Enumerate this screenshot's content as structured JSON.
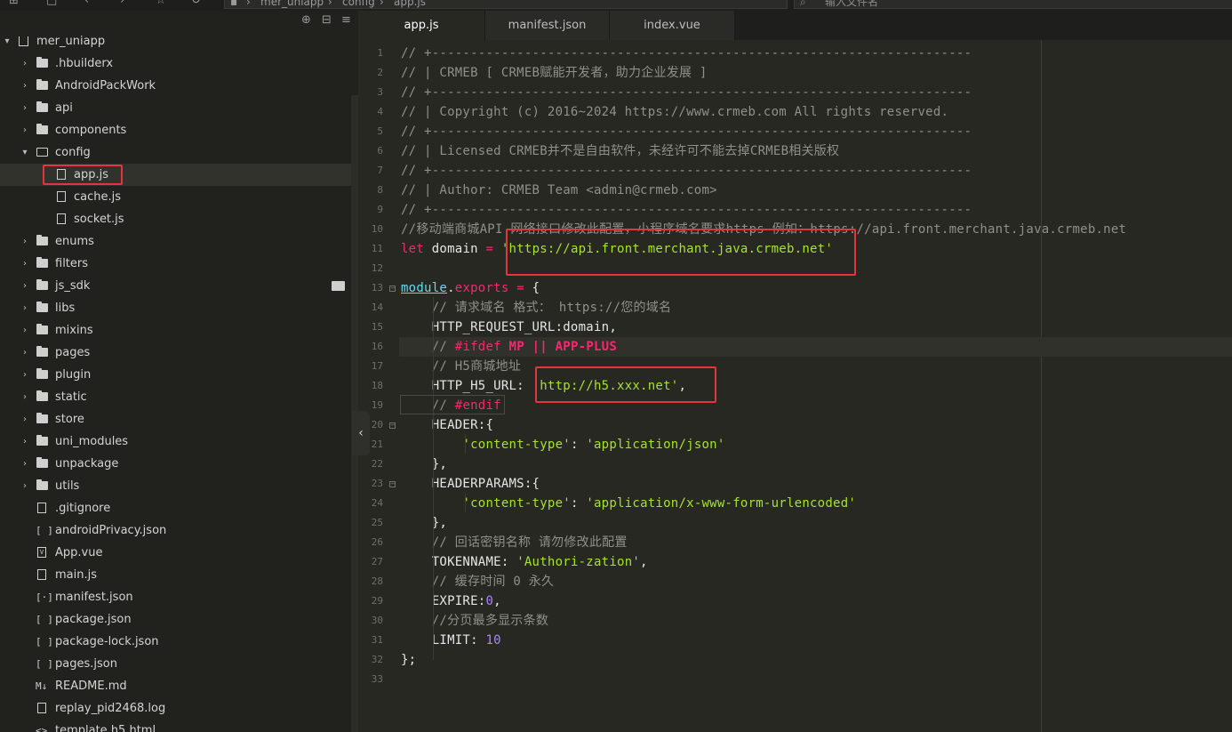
{
  "toolbar": {
    "icons": [
      "split-icon",
      "square-icon",
      "back-icon",
      "forward-icon",
      "star-icon",
      "refresh-icon"
    ],
    "breadcrumb": [
      "mer_uniapp",
      "config",
      "app.js"
    ],
    "search_placeholder": "输入文件名"
  },
  "sidebar": {
    "root": "mer_uniapp",
    "items": [
      {
        "label": ".hbuilderx",
        "type": "folder",
        "depth": 1,
        "expanded": false
      },
      {
        "label": "AndroidPackWork",
        "type": "folder",
        "depth": 1,
        "expanded": false
      },
      {
        "label": "api",
        "type": "folder",
        "depth": 1,
        "expanded": false
      },
      {
        "label": "components",
        "type": "folder",
        "depth": 1,
        "expanded": false
      },
      {
        "label": "config",
        "type": "folder",
        "depth": 1,
        "expanded": true
      },
      {
        "label": "app.js",
        "type": "js",
        "depth": 2,
        "selected": true
      },
      {
        "label": "cache.js",
        "type": "js",
        "depth": 2
      },
      {
        "label": "socket.js",
        "type": "js",
        "depth": 2
      },
      {
        "label": "enums",
        "type": "folder",
        "depth": 1,
        "expanded": false
      },
      {
        "label": "filters",
        "type": "folder",
        "depth": 1,
        "expanded": false
      },
      {
        "label": "js_sdk",
        "type": "folder",
        "depth": 1,
        "expanded": false,
        "hover": true
      },
      {
        "label": "libs",
        "type": "folder",
        "depth": 1,
        "expanded": false
      },
      {
        "label": "mixins",
        "type": "folder",
        "depth": 1,
        "expanded": false
      },
      {
        "label": "pages",
        "type": "folder",
        "depth": 1,
        "expanded": false
      },
      {
        "label": "plugin",
        "type": "folder",
        "depth": 1,
        "expanded": false
      },
      {
        "label": "static",
        "type": "folder",
        "depth": 1,
        "expanded": false
      },
      {
        "label": "store",
        "type": "folder",
        "depth": 1,
        "expanded": false
      },
      {
        "label": "uni_modules",
        "type": "folder",
        "depth": 1,
        "expanded": false
      },
      {
        "label": "unpackage",
        "type": "folder",
        "depth": 1,
        "expanded": false
      },
      {
        "label": "utils",
        "type": "folder",
        "depth": 1,
        "expanded": false
      },
      {
        "label": ".gitignore",
        "type": "file",
        "depth": 1
      },
      {
        "label": "androidPrivacy.json",
        "type": "json",
        "depth": 1
      },
      {
        "label": "App.vue",
        "type": "vue",
        "depth": 1
      },
      {
        "label": "main.js",
        "type": "js",
        "depth": 1
      },
      {
        "label": "manifest.json",
        "type": "manifest",
        "depth": 1
      },
      {
        "label": "package.json",
        "type": "json",
        "depth": 1
      },
      {
        "label": "package-lock.json",
        "type": "json",
        "depth": 1
      },
      {
        "label": "pages.json",
        "type": "json",
        "depth": 1
      },
      {
        "label": "README.md",
        "type": "md",
        "depth": 1
      },
      {
        "label": "replay_pid2468.log",
        "type": "file",
        "depth": 1
      },
      {
        "label": "template.h5.html",
        "type": "html",
        "depth": 1
      }
    ]
  },
  "tabs": [
    {
      "label": "app.js",
      "active": true
    },
    {
      "label": "manifest.json",
      "active": false
    },
    {
      "label": "index.vue",
      "active": false
    }
  ],
  "editor": {
    "line_numbers": [
      "1",
      "2",
      "3",
      "4",
      "5",
      "6",
      "7",
      "8",
      "9",
      "10",
      "11",
      "12",
      "13",
      "14",
      "15",
      "16",
      "17",
      "18",
      "19",
      "20",
      "21",
      "22",
      "23",
      "24",
      "25",
      "26",
      "27",
      "28",
      "29",
      "30",
      "31",
      "32",
      "33"
    ],
    "lines": [
      [
        {
          "t": "// +----------------------------------------------------------------------",
          "c": "c-com"
        }
      ],
      [
        {
          "t": "// | CRMEB [ CRMEB赋能开发者，助力企业发展 ]",
          "c": "c-com"
        }
      ],
      [
        {
          "t": "// +----------------------------------------------------------------------",
          "c": "c-com"
        }
      ],
      [
        {
          "t": "// | Copyright (c) 2016~2024 https://www.crmeb.com All rights reserved.",
          "c": "c-com"
        }
      ],
      [
        {
          "t": "// +----------------------------------------------------------------------",
          "c": "c-com"
        }
      ],
      [
        {
          "t": "// | Licensed CRMEB并不是自由软件，未经许可不能去掉CRMEB相关版权",
          "c": "c-com"
        }
      ],
      [
        {
          "t": "// +----------------------------------------------------------------------",
          "c": "c-com"
        }
      ],
      [
        {
          "t": "// | Author: CRMEB Team <admin@crmeb.com>",
          "c": "c-com"
        }
      ],
      [
        {
          "t": "// +----------------------------------------------------------------------",
          "c": "c-com"
        }
      ],
      [
        {
          "t": "//移动端商城API 网络接口修改此配置，小程序域名要求https 例如：https://api.front.merchant.java.crmeb.net",
          "c": "c-com"
        }
      ],
      [
        {
          "t": "let",
          "c": "c-key"
        },
        {
          "t": " domain ",
          "c": ""
        },
        {
          "t": "=",
          "c": "c-key"
        },
        {
          "t": " ",
          "c": ""
        },
        {
          "t": "'https://api.front.merchant.java.crmeb.net'",
          "c": "c-str"
        }
      ],
      [
        {
          "t": "",
          "c": ""
        }
      ],
      [
        {
          "t": "module",
          "c": "c-ident"
        },
        {
          "t": ".",
          "c": ""
        },
        {
          "t": "exports",
          "c": "c-prop"
        },
        {
          "t": " ",
          "c": ""
        },
        {
          "t": "=",
          "c": "c-key"
        },
        {
          "t": " {",
          "c": ""
        }
      ],
      [
        {
          "t": "    ",
          "c": ""
        },
        {
          "t": "// 请求域名 格式： https://您的域名",
          "c": "c-com"
        }
      ],
      [
        {
          "t": "    HTTP_REQUEST_URL:domain,",
          "c": ""
        }
      ],
      [
        {
          "t": "    ",
          "c": ""
        },
        {
          "t": "// ",
          "c": "c-com"
        },
        {
          "t": "#ifdef",
          "c": "c-pp"
        },
        {
          "t": " ",
          "c": ""
        },
        {
          "t": "MP || APP-PLUS",
          "c": "c-ppbold"
        }
      ],
      [
        {
          "t": "    ",
          "c": ""
        },
        {
          "t": "// H5商城地址",
          "c": "c-com"
        }
      ],
      [
        {
          "t": "    HTTP_H5_URL: ",
          "c": ""
        },
        {
          "t": "'http://h5.xxx.net'",
          "c": "c-str"
        },
        {
          "t": ",",
          "c": ""
        }
      ],
      [
        {
          "t": "    ",
          "c": ""
        },
        {
          "t": "// ",
          "c": "c-com"
        },
        {
          "t": "#endif",
          "c": "c-pp"
        }
      ],
      [
        {
          "t": "    HEADER:{",
          "c": ""
        }
      ],
      [
        {
          "t": "        ",
          "c": ""
        },
        {
          "t": "'content-type'",
          "c": "c-str"
        },
        {
          "t": ": ",
          "c": ""
        },
        {
          "t": "'application/json'",
          "c": "c-str"
        }
      ],
      [
        {
          "t": "    },",
          "c": ""
        }
      ],
      [
        {
          "t": "    HEADERPARAMS:{",
          "c": ""
        }
      ],
      [
        {
          "t": "        ",
          "c": ""
        },
        {
          "t": "'content-type'",
          "c": "c-str"
        },
        {
          "t": ": ",
          "c": ""
        },
        {
          "t": "'application/x-www-form-urlencoded'",
          "c": "c-str"
        }
      ],
      [
        {
          "t": "    },",
          "c": ""
        }
      ],
      [
        {
          "t": "    ",
          "c": ""
        },
        {
          "t": "// 回话密钥名称 请勿修改此配置",
          "c": "c-com"
        }
      ],
      [
        {
          "t": "    TOKENNAME: ",
          "c": ""
        },
        {
          "t": "'Authori-zation'",
          "c": "c-str"
        },
        {
          "t": ",",
          "c": ""
        }
      ],
      [
        {
          "t": "    ",
          "c": ""
        },
        {
          "t": "// 缓存时间 0 永久",
          "c": "c-com"
        }
      ],
      [
        {
          "t": "    EXPIRE:",
          "c": ""
        },
        {
          "t": "0",
          "c": "c-num"
        },
        {
          "t": ",",
          "c": ""
        }
      ],
      [
        {
          "t": "    ",
          "c": ""
        },
        {
          "t": "//分页最多显示条数",
          "c": "c-com"
        }
      ],
      [
        {
          "t": "    LIMIT: ",
          "c": ""
        },
        {
          "t": "10",
          "c": "c-num"
        }
      ],
      [
        {
          "t": "};",
          "c": ""
        }
      ],
      [
        {
          "t": "",
          "c": ""
        }
      ]
    ],
    "fold_lines": [
      13,
      20,
      23
    ]
  },
  "colors": {
    "highlight_box": "#e2363c",
    "editor_bg": "#272822",
    "sidebar_bg": "#21221e",
    "string": "#a6e22e",
    "keyword": "#f92672",
    "comment": "#8f908a",
    "number": "#ae81ff"
  }
}
